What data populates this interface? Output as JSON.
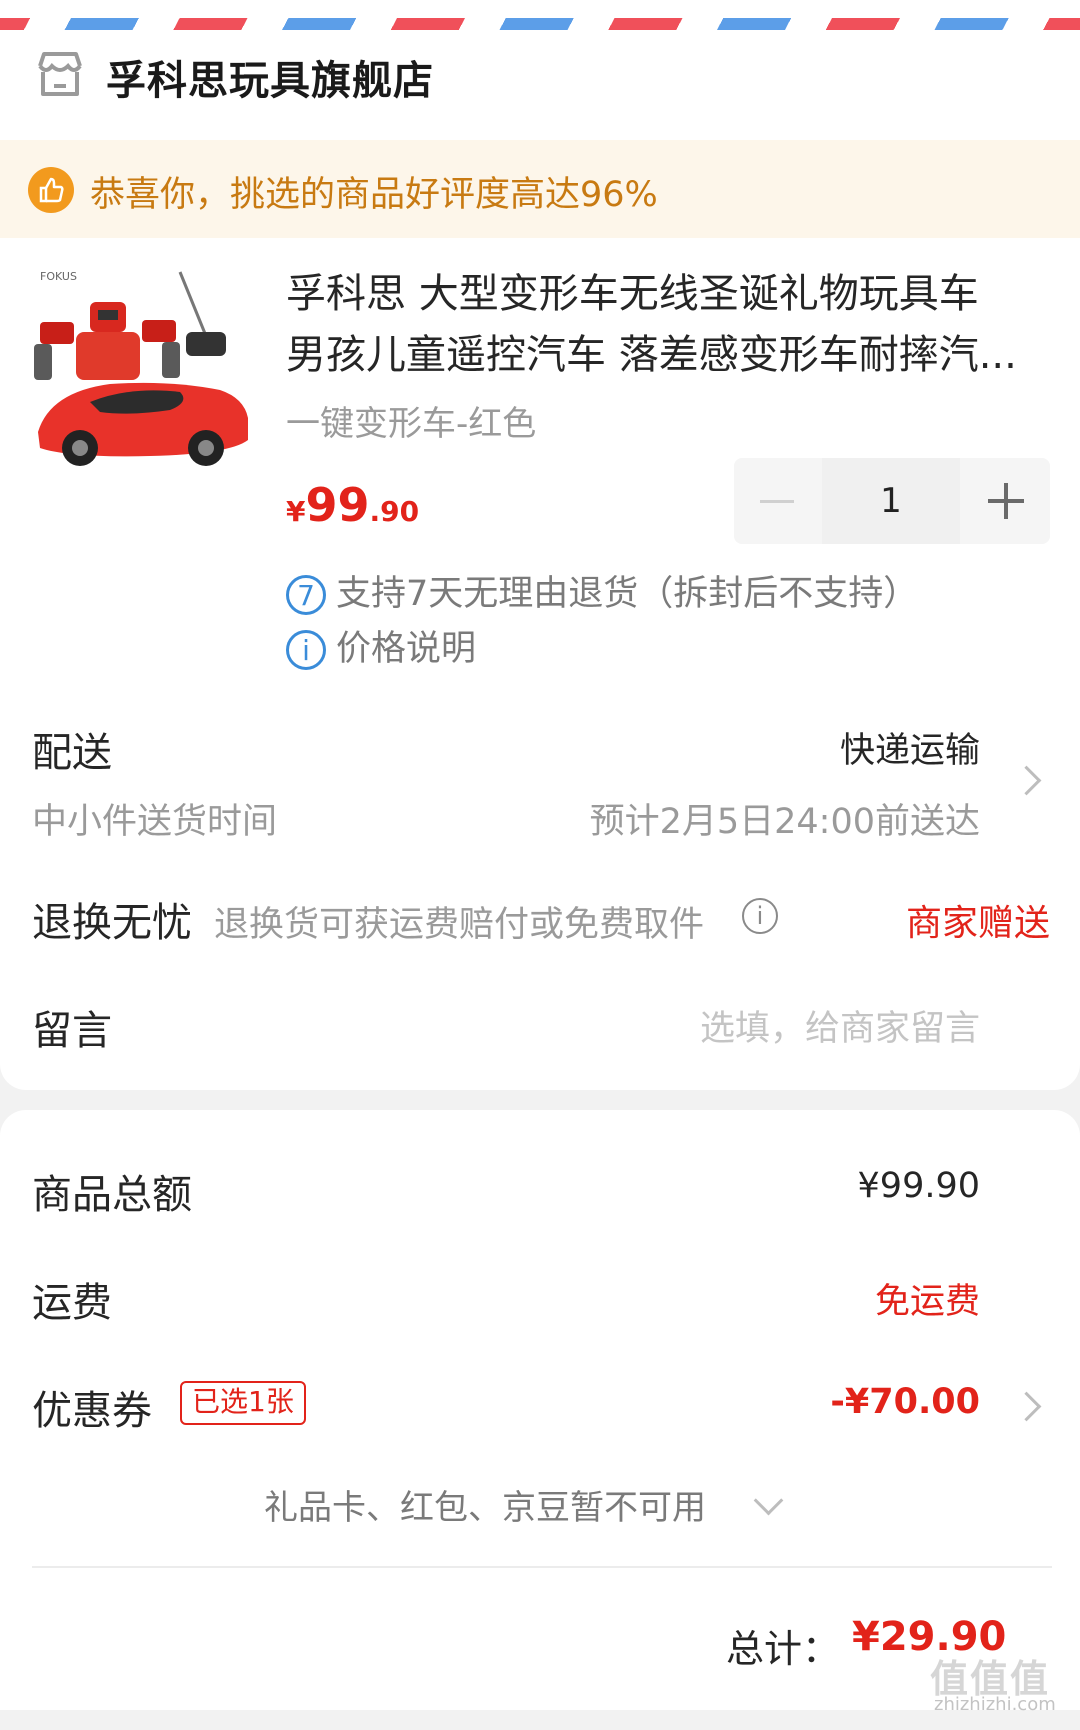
{
  "shop": {
    "name": "孚科思玩具旗舰店",
    "icon": "store-icon"
  },
  "notice": {
    "text": "恭喜你，挑选的商品好评度高达96%",
    "icon": "thumbs-up-icon"
  },
  "product": {
    "title_line1": "孚科思 大型变形车无线圣诞礼物玩具车",
    "title_line2": "男孩儿童遥控汽车 落差感变形车耐摔汽...",
    "variant": "一键变形车-红色",
    "price_symbol": "¥",
    "price_int": "99",
    "price_dec": ".90",
    "quantity": "1",
    "service_return": "支持7天无理由退货（拆封后不支持）",
    "service_return_icon_text": "7",
    "service_price": "价格说明",
    "service_price_icon_text": "i"
  },
  "delivery": {
    "label": "配送",
    "method": "快递运输",
    "sub_label": "中小件送货时间",
    "eta": "预计2月5日24:00前送达"
  },
  "returns": {
    "label": "退换无忧",
    "desc": "退换货可获运费赔付或免费取件",
    "info_icon_text": "i",
    "value": "商家赠送"
  },
  "message": {
    "label": "留言",
    "placeholder": "选填，给商家留言"
  },
  "summary": {
    "goods_total_label": "商品总额",
    "goods_total_value": "¥99.90",
    "shipping_label": "运费",
    "shipping_value": "免运费",
    "coupon_label": "优惠券",
    "coupon_badge": "已选1张",
    "coupon_value": "-¥70.00",
    "giftcard_text": "礼品卡、红包、京豆暂不可用",
    "total_label": "总计：",
    "total_value": "¥29.90"
  },
  "watermark": {
    "text": "值值值",
    "url_text": "zhizhizhi.com"
  },
  "colors": {
    "accent_red": "#e2231a",
    "notice_orange": "#c87a12",
    "icon_blue": "#3a8cd9"
  }
}
